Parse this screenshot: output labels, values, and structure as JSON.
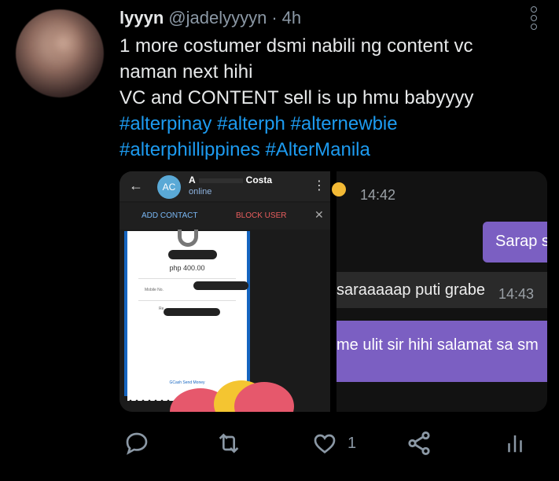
{
  "tweet": {
    "display_name": "lyyyn",
    "handle": "@jadelyyyyn",
    "separator": "·",
    "time": "4h",
    "lines": [
      "1 more costumer dsmi nabili ng content vc",
      "naman next hihi",
      "VC and CONTENT sell is up hmu babyyyy"
    ],
    "hashtags_line1": [
      "#alterpinay",
      "#alterph",
      "#alternewbie"
    ],
    "hashtags_line2": [
      "#alterphillippines",
      "#AlterManila"
    ]
  },
  "media_left": {
    "contact_initials": "AC",
    "contact_name_start": "A",
    "contact_name_end": "Costa",
    "contact_status": "online",
    "add_contact": "ADD CONTACT",
    "block_user": "BLOCK USER",
    "receipt_amount": "php 400.00",
    "receipt_mobile_label": "Mobile No.",
    "receipt_ref_label": "Re",
    "receipt_footer": "GCash Send Money"
  },
  "media_right": {
    "time_1": "14:42",
    "bubble_sarap": "Sarap s",
    "msg_saraaap": "saraaaaap puti grabe",
    "time_2": "14:43",
    "msg_meulit": "me ulit sir hihi salamat sa sm"
  },
  "actions": {
    "like_count": "1"
  },
  "colors": {
    "accent": "#1d9bf0",
    "muted": "#8b98a5",
    "chat_purple": "#7b5fc2"
  },
  "icons": [
    "reply-icon",
    "retweet-icon",
    "like-icon",
    "share-icon",
    "analytics-icon",
    "more-icon"
  ]
}
